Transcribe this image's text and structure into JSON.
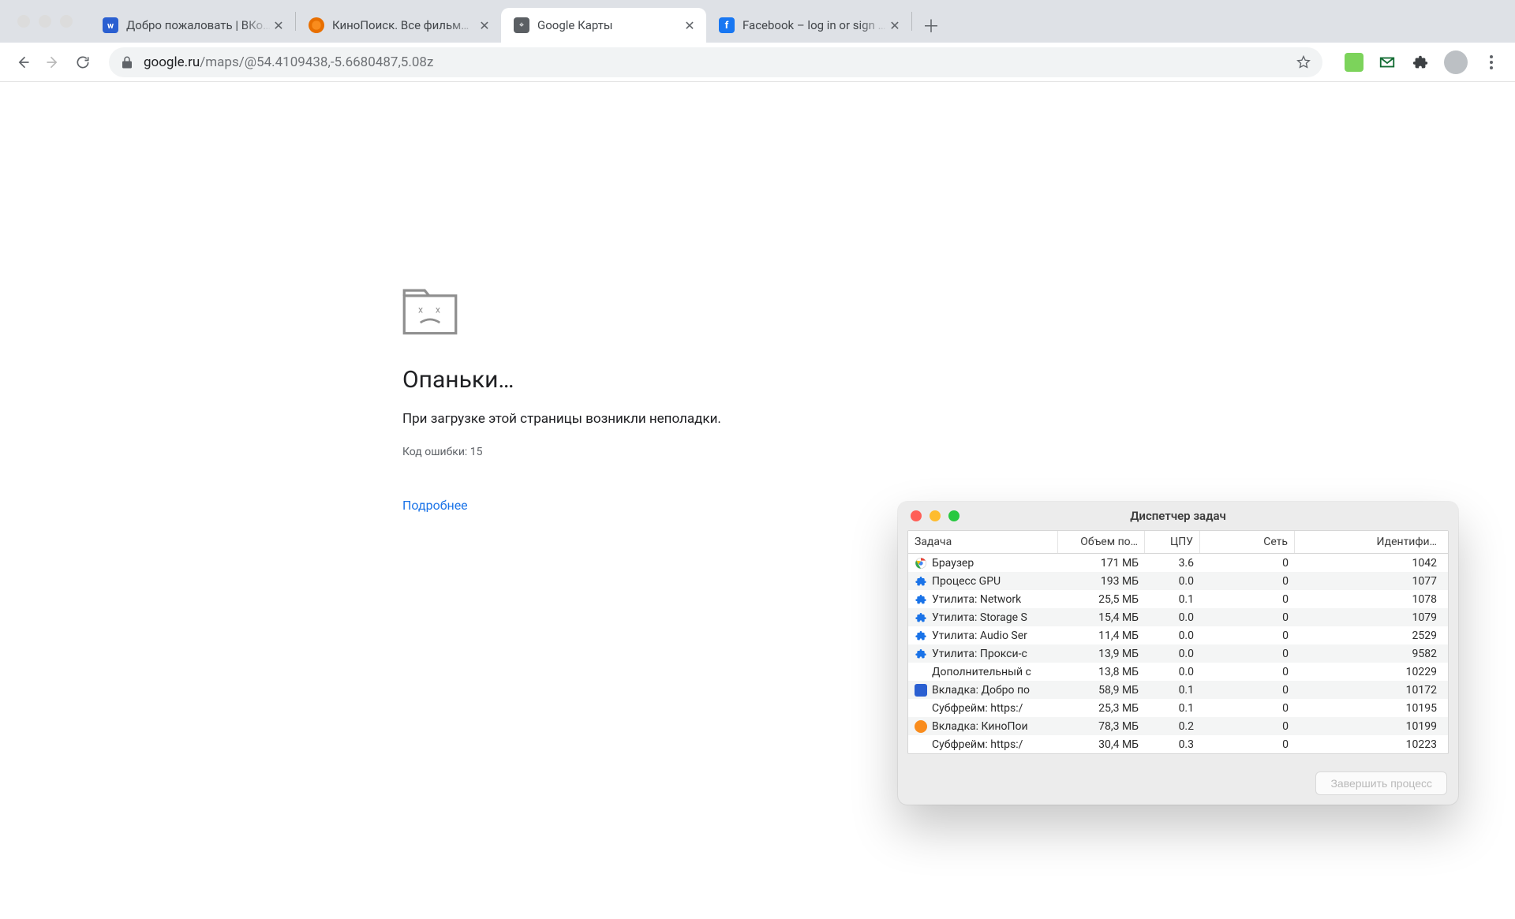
{
  "tabs": [
    {
      "title": "Добро пожаловать | ВКонтак",
      "favicon": "vk"
    },
    {
      "title": "КиноПоиск. Все фильмы план",
      "favicon": "kp"
    },
    {
      "title": "Google Карты",
      "favicon": "gm",
      "active": true
    },
    {
      "title": "Facebook – log in or sign up",
      "favicon": "fb"
    }
  ],
  "address": {
    "host": "google.ru",
    "path": "/maps/@54.4109438,-5.6680487,5.08z"
  },
  "error": {
    "title": "Опаньки…",
    "message": "При загрузке этой страницы возникли неполадки.",
    "code": "Код ошибки: 15",
    "learn_more": "Подробнее"
  },
  "task_manager": {
    "title": "Диспетчер задач",
    "columns": {
      "task": "Задача",
      "memory": "Объем по…",
      "cpu": "ЦПУ",
      "network": "Сеть",
      "id": "Идентифи…"
    },
    "rows": [
      {
        "icon": "chrome",
        "name": "Браузер",
        "mem": "171 МБ",
        "cpu": "3.6",
        "net": "0",
        "id": "1042"
      },
      {
        "icon": "ext",
        "name": "Процесс GPU",
        "mem": "193 МБ",
        "cpu": "0.0",
        "net": "0",
        "id": "1077"
      },
      {
        "icon": "ext",
        "name": "Утилита: Network",
        "mem": "25,5 МБ",
        "cpu": "0.1",
        "net": "0",
        "id": "1078"
      },
      {
        "icon": "ext",
        "name": "Утилита: Storage S",
        "mem": "15,4 МБ",
        "cpu": "0.0",
        "net": "0",
        "id": "1079"
      },
      {
        "icon": "ext",
        "name": "Утилита: Audio Ser",
        "mem": "11,4 МБ",
        "cpu": "0.0",
        "net": "0",
        "id": "2529"
      },
      {
        "icon": "ext",
        "name": "Утилита: Прокси-с",
        "mem": "13,9 МБ",
        "cpu": "0.0",
        "net": "0",
        "id": "9582"
      },
      {
        "icon": "none",
        "name": "Дополнительный с",
        "mem": "13,8 МБ",
        "cpu": "0.0",
        "net": "0",
        "id": "10229"
      },
      {
        "icon": "vk",
        "name": "Вкладка: Добро по",
        "mem": "58,9 МБ",
        "cpu": "0.1",
        "net": "0",
        "id": "10172"
      },
      {
        "icon": "none",
        "name": "Субфрейм: https:/",
        "mem": "25,3 МБ",
        "cpu": "0.1",
        "net": "0",
        "id": "10195"
      },
      {
        "icon": "kp",
        "name": "Вкладка: КиноПои",
        "mem": "78,3 МБ",
        "cpu": "0.2",
        "net": "0",
        "id": "10199"
      },
      {
        "icon": "none",
        "name": "Субфрейм: https:/",
        "mem": "30,4 МБ",
        "cpu": "0.3",
        "net": "0",
        "id": "10223"
      }
    ],
    "end_process": "Завершить процесс"
  }
}
